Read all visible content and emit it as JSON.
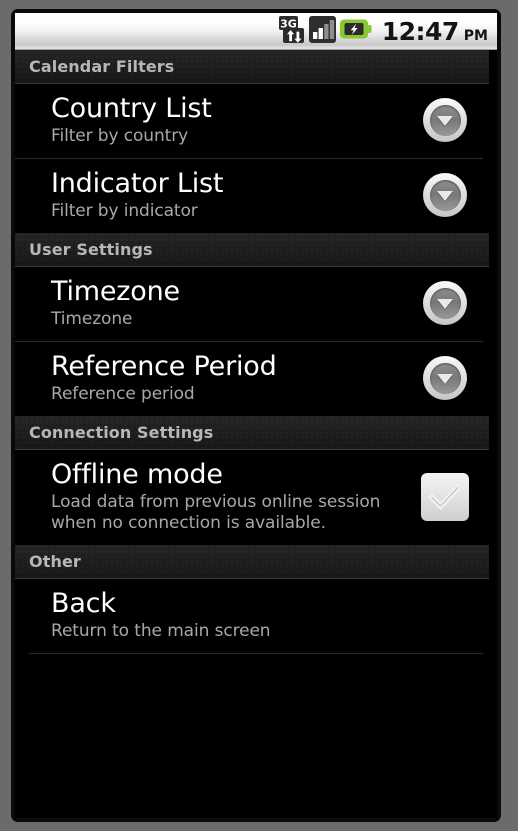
{
  "status_bar": {
    "icons": [
      {
        "name": "3g-data-icon",
        "label": "3G"
      },
      {
        "name": "signal-bars-icon",
        "label": "signal"
      },
      {
        "name": "battery-charging-icon",
        "label": "battery charging"
      }
    ],
    "clock": {
      "time": "12:47",
      "ampm": "PM"
    }
  },
  "colors": {
    "background": "#000000",
    "header_bg": "#1d1d1d",
    "header_text": "#b7b7b7",
    "title_text": "#ffffff",
    "summary_text": "#a8a8a8",
    "divider": "#2b2b2b",
    "frame": "#6b6b6b",
    "battery_green": "#8ac832"
  },
  "sections": [
    {
      "header": "Calendar Filters",
      "items": [
        {
          "title": "Country List",
          "summary": "Filter by country",
          "widget": "dropdown"
        },
        {
          "title": "Indicator List",
          "summary": "Filter by indicator",
          "widget": "dropdown"
        }
      ]
    },
    {
      "header": "User Settings",
      "items": [
        {
          "title": "Timezone",
          "summary": "Timezone",
          "widget": "dropdown"
        },
        {
          "title": "Reference Period",
          "summary": "Reference period",
          "widget": "dropdown"
        }
      ]
    },
    {
      "header": "Connection Settings",
      "items": [
        {
          "title": "Offline mode",
          "summary": "Load data from previous online session when no connection is available.",
          "widget": "checkbox",
          "checked": false
        }
      ]
    },
    {
      "header": "Other",
      "items": [
        {
          "title": "Back",
          "summary": "Return to the main screen",
          "widget": "none"
        }
      ]
    }
  ]
}
